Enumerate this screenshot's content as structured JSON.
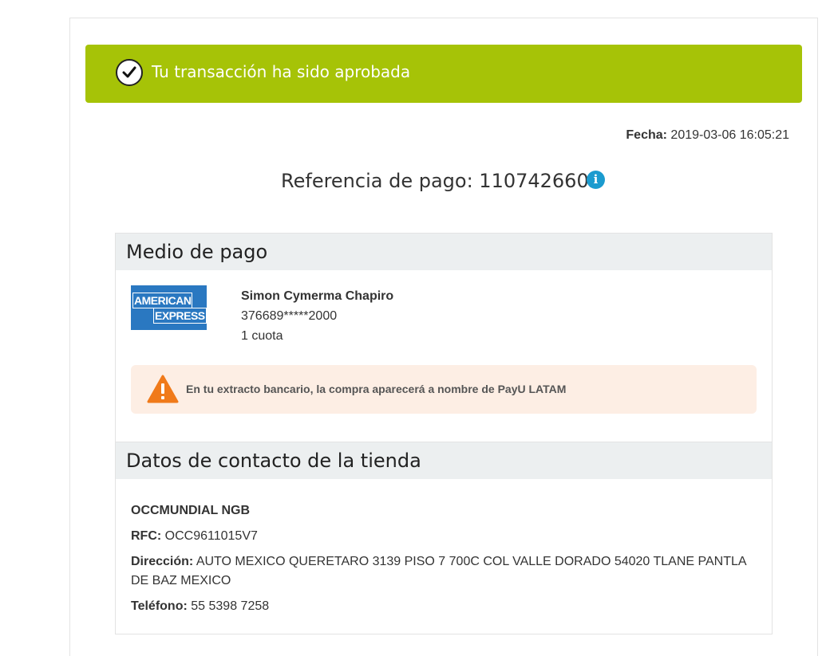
{
  "banner": {
    "text": "Tu transacción ha sido aprobada",
    "icon": "checkmark-circle-icon",
    "color": "#a6c307"
  },
  "fecha": {
    "label": "Fecha:",
    "value": "2019-03-06  16:05:21"
  },
  "reference": {
    "text": "Referencia de pago: 1107426602",
    "info_icon": "i"
  },
  "payment": {
    "title": "Medio de pago",
    "card_brand": {
      "line1": "AMERICAN",
      "line2": "EXPRESS"
    },
    "holder": "Simon Cymerma Chapiro",
    "card_number": "376689*****2000",
    "installments": "1 cuota",
    "warning": "En tu extracto bancario, la compra aparecerá a nombre de PayU LATAM"
  },
  "store": {
    "title": "Datos de contacto de la tienda",
    "name": "OCCMUNDIAL NGB",
    "rfc_label": "RFC:",
    "rfc_value": "OCC9611015V7",
    "address_label": "Dirección:",
    "address_value": "AUTO MEXICO QUERETARO 3139 PISO 7 700C COL VALLE DORADO 54020 TLANE PANTLA DE BAZ MEXICO",
    "phone_label": "Teléfono:",
    "phone_value": "55 5398 7258"
  }
}
